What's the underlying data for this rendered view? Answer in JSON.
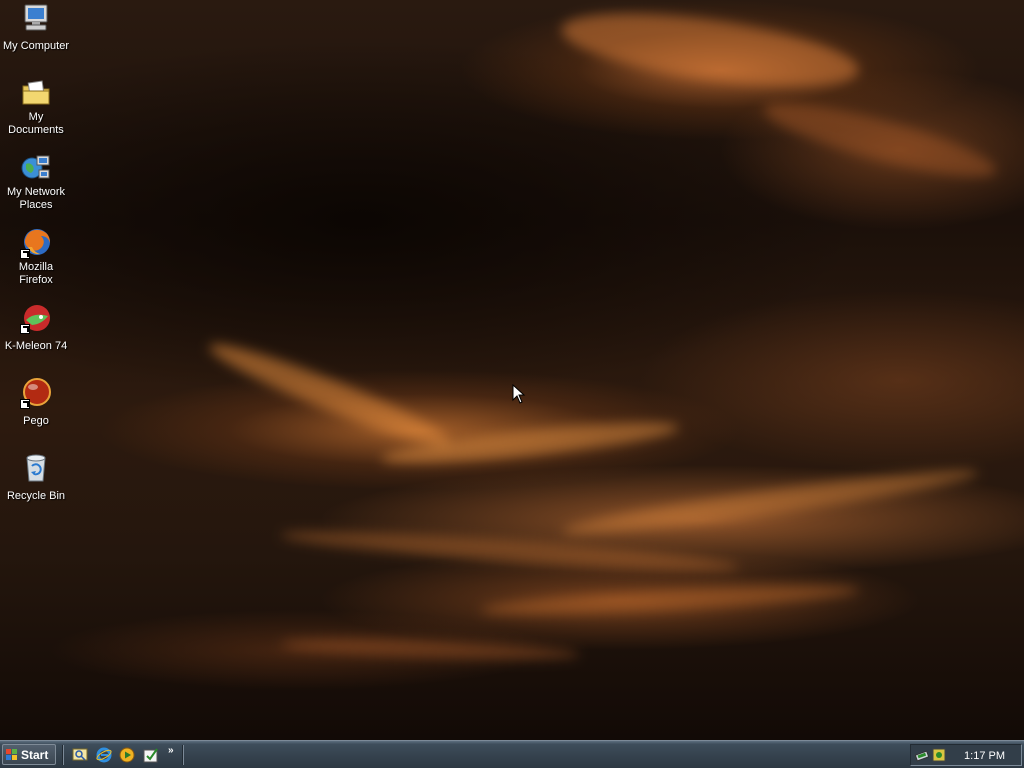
{
  "desktop": {
    "icons": [
      {
        "label": "My Computer",
        "icon": "my-computer-icon"
      },
      {
        "label": "My Documents",
        "icon": "my-documents-icon"
      },
      {
        "label": "My Network Places",
        "icon": "network-places-icon"
      },
      {
        "label": "Mozilla Firefox",
        "icon": "firefox-icon"
      },
      {
        "label": "K-Meleon 74",
        "icon": "k-meleon-icon"
      },
      {
        "label": "Pego",
        "icon": "pego-icon"
      },
      {
        "label": "Recycle Bin",
        "icon": "recycle-bin-icon"
      }
    ]
  },
  "taskbar": {
    "start_label": "Start",
    "quick_launch": [
      {
        "icon": "show-desktop-icon"
      },
      {
        "icon": "internet-explorer-icon"
      },
      {
        "icon": "media-player-icon"
      },
      {
        "icon": "launch-app-icon"
      }
    ],
    "chevron": "»",
    "tray_icons": [
      {
        "icon": "network-tray-icon"
      },
      {
        "icon": "security-tray-icon"
      }
    ],
    "clock": "1:17 PM"
  },
  "colors": {
    "taskbar": "#36434f",
    "accent": "#c86e32"
  }
}
